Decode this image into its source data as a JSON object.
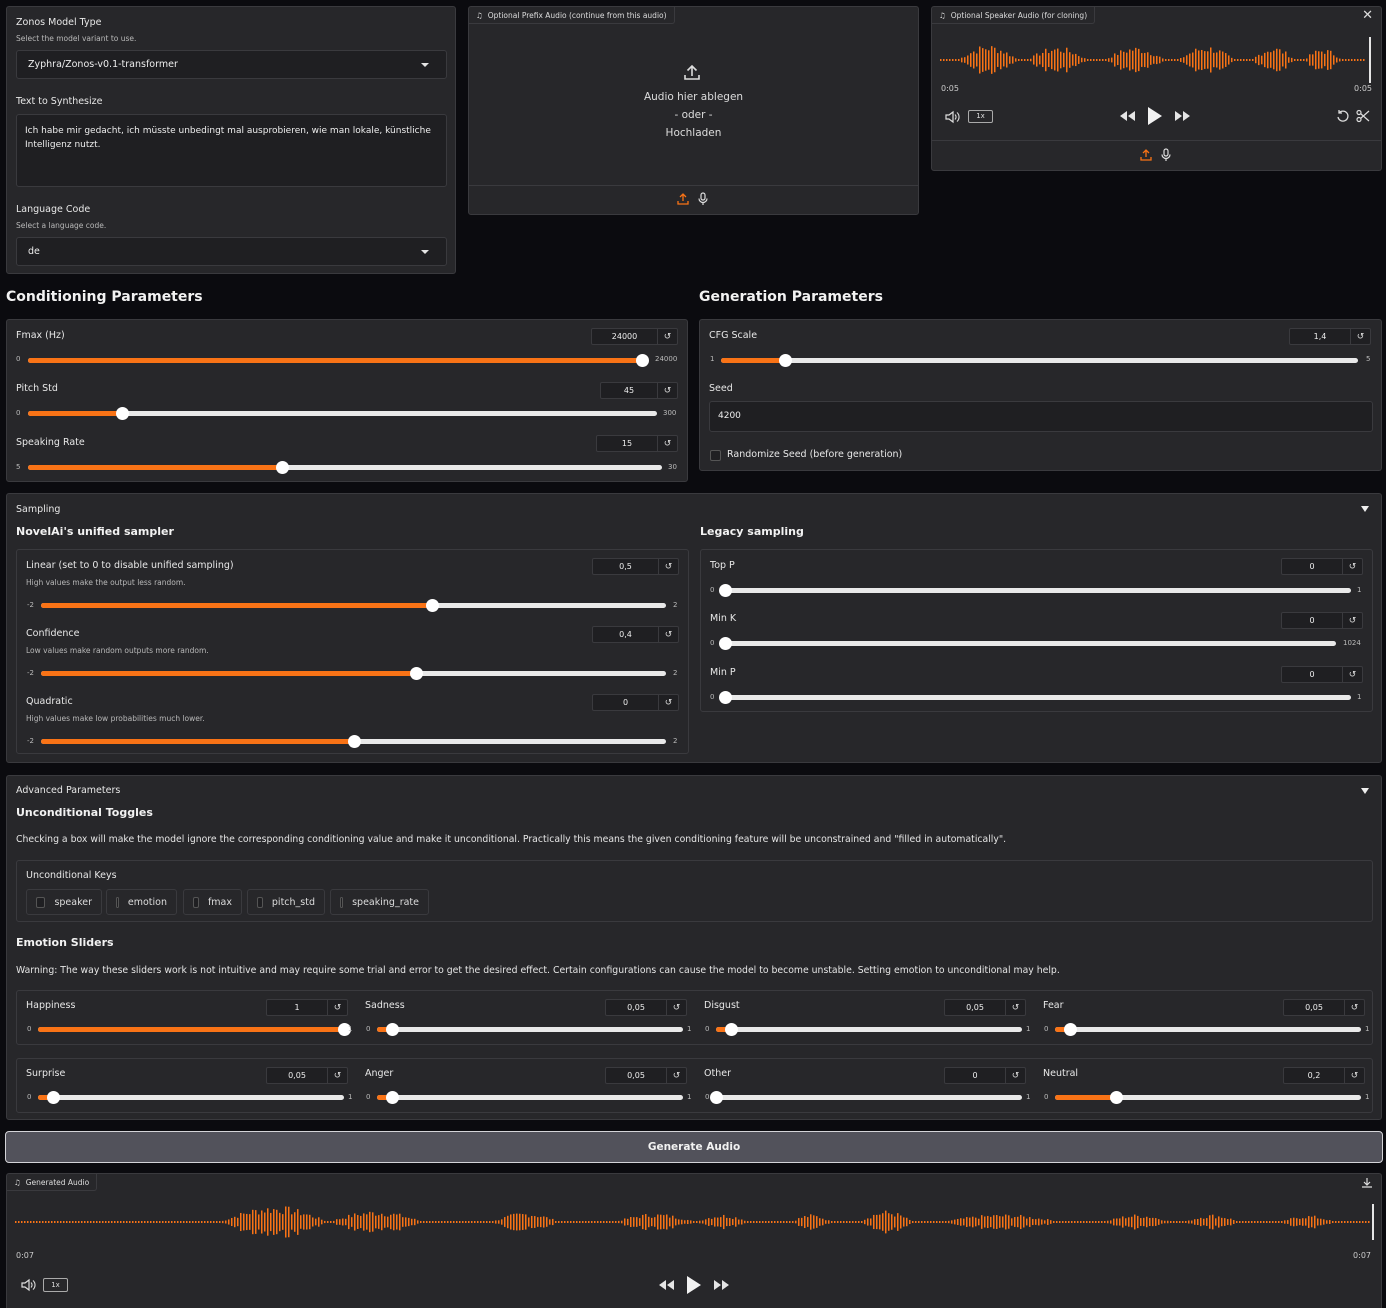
{
  "model": {
    "label": "Zonos Model Type",
    "info": "Select the model variant to use.",
    "value": "Zyphra/Zonos-v0.1-transformer"
  },
  "text": {
    "label": "Text to Synthesize",
    "value": "Ich habe mir gedacht, ich müsste unbedingt mal ausprobieren, wie man lokale, künstliche Intelligenz nutzt."
  },
  "language": {
    "label": "Language Code",
    "info": "Select a language code.",
    "value": "de"
  },
  "prefix_audio": {
    "label": "Optional Prefix Audio (continue from this audio)",
    "drop": "Audio hier ablegen",
    "or": "- oder -",
    "upload": "Hochladen"
  },
  "speaker_audio": {
    "label": "Optional Speaker Audio (for cloning)",
    "time_start": "0:05",
    "time_end": "0:05",
    "speed": "1x"
  },
  "conditioning": {
    "title": "Conditioning Parameters",
    "sliders": [
      {
        "label": "Fmax (Hz)",
        "value": "24000",
        "min": "0",
        "max": "24000",
        "frac": 1.0
      },
      {
        "label": "Pitch Std",
        "value": "45",
        "min": "0",
        "max": "300",
        "frac": 0.15
      },
      {
        "label": "Speaking Rate",
        "value": "15",
        "min": "5",
        "max": "30",
        "frac": 0.4
      }
    ]
  },
  "generation": {
    "title": "Generation Parameters",
    "cfg": {
      "label": "CFG Scale",
      "value": "1,4",
      "min": "1",
      "max": "5",
      "frac": 0.1
    },
    "seed": {
      "label": "Seed",
      "value": "4200"
    },
    "randomize": "Randomize Seed (before generation)"
  },
  "sampling": {
    "title": "Sampling",
    "unified_title": "NovelAi's unified sampler",
    "legacy_title": "Legacy sampling",
    "unified": [
      {
        "label": "Linear (set to 0 to disable unified sampling)",
        "info": "High values make the output less random.",
        "value": "0,5",
        "min": "-2",
        "max": "2",
        "frac": 0.625
      },
      {
        "label": "Confidence",
        "info": "Low values make random outputs more random.",
        "value": "0,4",
        "min": "-2",
        "max": "2",
        "frac": 0.6
      },
      {
        "label": "Quadratic",
        "info": "High values make low probabilities much lower.",
        "value": "0",
        "min": "-2",
        "max": "2",
        "frac": 0.5
      }
    ],
    "legacy": [
      {
        "label": "Top P",
        "value": "0",
        "min": "0",
        "max": "1",
        "frac": 0
      },
      {
        "label": "Min K",
        "value": "0",
        "min": "0",
        "max": "1024",
        "frac": 0
      },
      {
        "label": "Min P",
        "value": "0",
        "min": "0",
        "max": "1",
        "frac": 0
      }
    ]
  },
  "advanced": {
    "title": "Advanced Parameters",
    "toggles_title": "Unconditional Toggles",
    "toggles_desc": "Checking a box will make the model ignore the corresponding conditioning value and make it unconditional. Practically this means the given conditioning feature will be unconstrained and \"filled in automatically\".",
    "keys_label": "Unconditional Keys",
    "keys": [
      "speaker",
      "emotion",
      "fmax",
      "pitch_std",
      "speaking_rate"
    ],
    "emotion_title": "Emotion Sliders",
    "emotion_warning": "Warning: The way these sliders work is not intuitive and may require some trial and error to get the desired effect. Certain configurations can cause the model to become unstable. Setting emotion to unconditional may help.",
    "emotions": [
      {
        "label": "Happiness",
        "value": "1",
        "frac": 1.0
      },
      {
        "label": "Sadness",
        "value": "0,05",
        "frac": 0.05
      },
      {
        "label": "Disgust",
        "value": "0,05",
        "frac": 0.05
      },
      {
        "label": "Fear",
        "value": "0,05",
        "frac": 0.05
      },
      {
        "label": "Surprise",
        "value": "0,05",
        "frac": 0.05
      },
      {
        "label": "Anger",
        "value": "0,05",
        "frac": 0.05
      },
      {
        "label": "Other",
        "value": "0",
        "frac": 0
      },
      {
        "label": "Neutral",
        "value": "0,2",
        "frac": 0.2
      }
    ],
    "emotion_min": "0",
    "emotion_max": "1"
  },
  "generate_button": "Generate Audio",
  "generated": {
    "label": "Generated Audio",
    "time_start": "0:07",
    "time_end": "0:07",
    "speed": "1x"
  },
  "colors": {
    "accent": "#f97316",
    "panel": "#27272a",
    "bg": "#0b0b0f"
  }
}
